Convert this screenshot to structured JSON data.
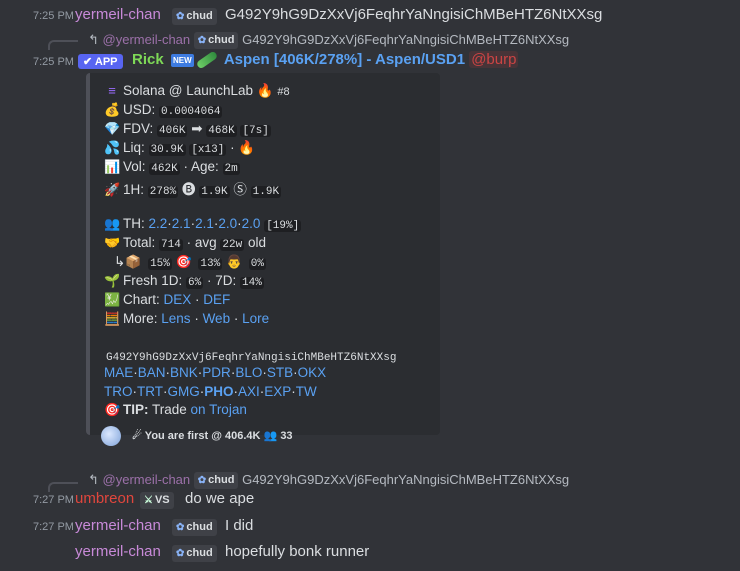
{
  "messages": [
    {
      "time": "7:25 PM",
      "user": "yermeil-chan",
      "tag": "chud",
      "text": "G492Y9hG9DzXxVj6FeqhrYaNngisiChMBeHTZ6NtXXsg"
    },
    {
      "time": "7:25 PM",
      "user": "Rick",
      "tag": "APP",
      "text": "Aspen [406K/278%] - Aspen/USD1",
      "mention": "@burp"
    },
    {
      "time": "7:27 PM",
      "user": "umbreon",
      "tag": "VS",
      "text": "do we ape"
    },
    {
      "time": "7:27 PM",
      "user": "yermeil-chan",
      "tag": "chud",
      "text": "I did"
    },
    {
      "time": "",
      "user": "yermeil-chan",
      "tag": "chud",
      "text": "hopefully bonk runner"
    }
  ],
  "reply": {
    "arrow": "↰",
    "user": "@yermeil-chan",
    "tag": "chud",
    "text": "G492Y9hG9DzXxVj6FeqhrYaNngisiChMBeHTZ6NtXXsg"
  },
  "embed": {
    "header": "Solana @ LaunchLab",
    "rank": "#8",
    "usd_label": "USD:",
    "usd": "0.0004064",
    "fdv_label": "FDV:",
    "fdv_from": "406K",
    "fdv_to": "468K",
    "fdv_time": "[7s]",
    "liq_label": "Liq:",
    "liq": "30.9K",
    "liq_mult": "[x13]",
    "vol_label": "Vol:",
    "vol": "462K",
    "age_label": "Age:",
    "age": "2m",
    "h1_label": "1H:",
    "h1_pct": "278%",
    "h1_a": "1.9K",
    "h1_b": "1.9K",
    "th_label": "TH:",
    "th_values": [
      "2.2",
      "2.1",
      "2.1",
      "2.0",
      "2.0"
    ],
    "th_pct": "[19%]",
    "total_label": "Total:",
    "total": "714",
    "avg_label": "avg",
    "avg": "22w",
    "old_label": "old",
    "sub_a": "15%",
    "sub_b": "13%",
    "sub_c": "0%",
    "fresh_label": "Fresh 1D:",
    "fresh_1d": "6%",
    "fresh_7d_label": "7D:",
    "fresh_7d": "14%",
    "chart_label": "Chart:",
    "chart_links": [
      "DEX",
      "DEF"
    ],
    "more_label": "More:",
    "more_links": [
      "Lens",
      "Web",
      "Lore"
    ],
    "address": "G492Y9hG9DzXxVj6FeqhrYaNngisiChMBeHTZ6NtXXsg",
    "links_row1": [
      "MAE",
      "BAN",
      "BNK",
      "PDR",
      "BLO",
      "STB",
      "OKX"
    ],
    "links_row2": [
      "TRO",
      "TRT",
      "GMG",
      "PHO",
      "AXI",
      "EXP",
      "TW"
    ],
    "tip_label": "TIP:",
    "tip_text": "Trade",
    "tip_link": "on Trojan",
    "footer": "You are first @ 406.4K",
    "footer_count": "33"
  },
  "colors": {
    "bg": "#313338",
    "embed_bg": "#2b2d31",
    "yermeil": "#c88ad8",
    "rick": "#7ed957",
    "umbreon": "#e0463d",
    "link": "#5aa1f2",
    "aspen": "#5aa1f2"
  }
}
